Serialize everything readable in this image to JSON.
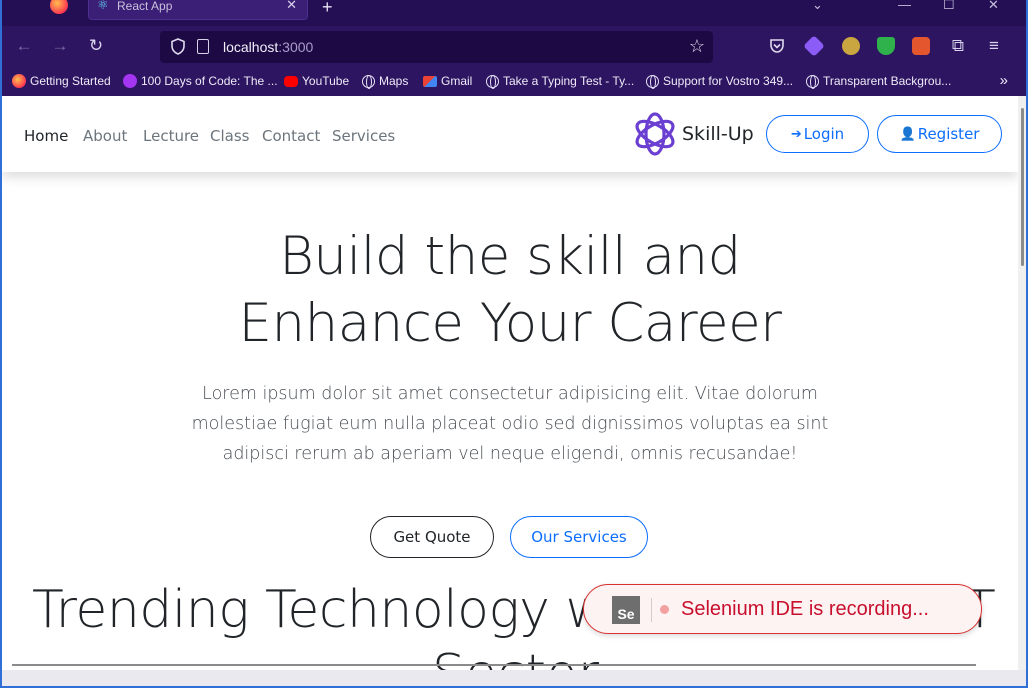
{
  "browser": {
    "tab_title": "React App",
    "url_host": "localhost",
    "url_port": ":3000",
    "accent": "#2d1561"
  },
  "bookmarks": [
    {
      "label": "Getting Started",
      "icon": "firefox-icon"
    },
    {
      "label": "100 Days of Code: The ...",
      "icon": "udemy-icon"
    },
    {
      "label": "YouTube",
      "icon": "youtube-icon"
    },
    {
      "label": "Maps",
      "icon": "globe-icon"
    },
    {
      "label": "Gmail",
      "icon": "gmail-icon"
    },
    {
      "label": "Take a Typing Test - Ty...",
      "icon": "globe-icon"
    },
    {
      "label": "Support for Vostro 349...",
      "icon": "globe-icon"
    },
    {
      "label": "Transparent Backgrou...",
      "icon": "globe-icon"
    }
  ],
  "site": {
    "menu": [
      "Home",
      "About",
      "Lecture",
      "Class",
      "Contact",
      "Services"
    ],
    "brand": "Skill-Up",
    "login_label": "Login",
    "register_label": "Register",
    "hero_line1": "Build the skill and",
    "hero_line2": "Enhance Your Career",
    "hero_text1": "Lorem ipsum dolor sit amet consectetur adipisicing elit. Vitae dolorum",
    "hero_text2": "molestiae fugiat eum nulla placeat odio sed dignissimos voluptas ea sint",
    "hero_text3": "adipisci rerum ab aperiam vel neque eligendi, omnis recusandae!",
    "quote_label": "Get Quote",
    "services_label": "Our Services",
    "trending_line1": "Trending Technology wh",
    "trending_tail": "T",
    "trending_line2": "Sector",
    "primary_color": "#0d6efd"
  },
  "selenium": {
    "status": "Selenium IDE is recording...",
    "icon_text": "Se"
  }
}
